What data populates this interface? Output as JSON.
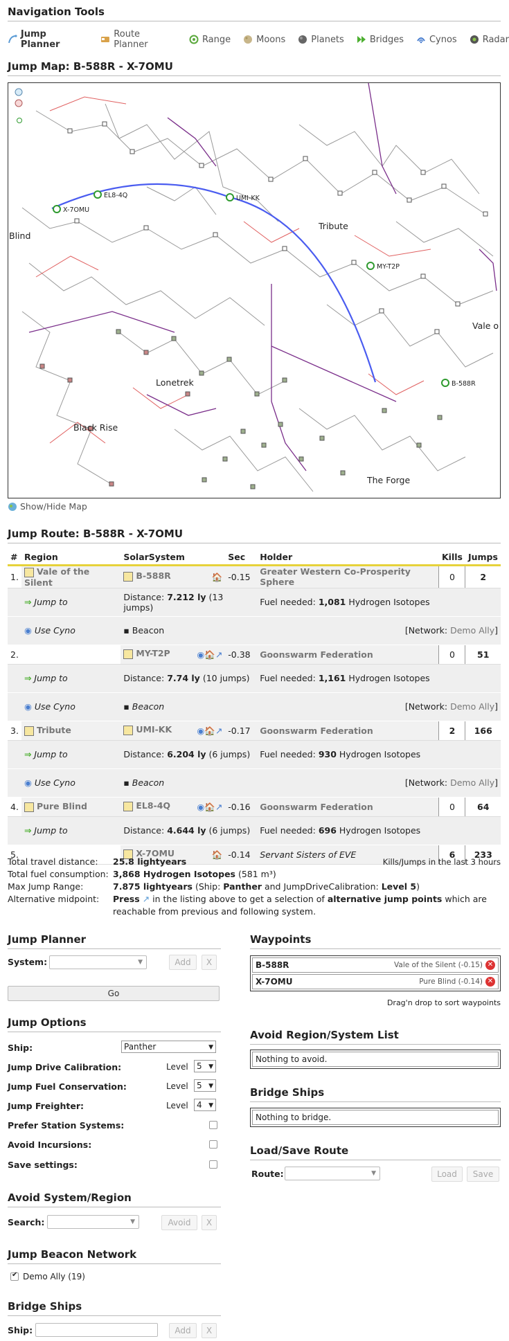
{
  "nav": {
    "title": "Navigation Tools",
    "items": [
      {
        "label": "Jump Planner",
        "icon": "jump-planner-icon",
        "active": true
      },
      {
        "label": "Route Planner",
        "icon": "route-planner-icon"
      },
      {
        "label": "Range",
        "icon": "range-icon"
      },
      {
        "label": "Moons",
        "icon": "moon-icon"
      },
      {
        "label": "Planets",
        "icon": "planet-icon"
      },
      {
        "label": "Bridges",
        "icon": "bridges-icon"
      },
      {
        "label": "Cynos",
        "icon": "cyno-icon"
      },
      {
        "label": "Radar",
        "icon": "radar-icon"
      }
    ]
  },
  "map": {
    "title": "Jump Map: B-588R - X-7OMU",
    "labels": {
      "blind": "Blind",
      "tribute": "Tribute",
      "vale": "Vale o",
      "lonetrek": "Lonetrek",
      "black_rise": "Black Rise",
      "the_forge": "The Forge"
    },
    "route_systems": [
      "X-7OMU",
      "EL8-4Q",
      "UMI-KK",
      "MY-T2P",
      "B-588R"
    ],
    "show_hide": "Show/Hide Map"
  },
  "route": {
    "title": "Jump Route: B-588R - X-7OMU",
    "columns": [
      "#",
      "Region",
      "SolarSystem",
      "Sec",
      "Holder",
      "Kills",
      "Jumps"
    ],
    "rows": [
      {
        "num": "1.",
        "region": "Vale of the Silent",
        "system": "B-588R",
        "sec": "-0.15",
        "holder": "Greater Western Co-Prosperity Sphere",
        "kills": "0",
        "jumps": "2",
        "jump_label": "Jump to",
        "distance_label": "Distance:",
        "distance": "7.212 ly",
        "distance_jumps": "(13 jumps)",
        "fuel_label": "Fuel needed:",
        "fuel": "1,081",
        "fuel_type": "Hydrogen Isotopes",
        "cyno_label": "Use Cyno",
        "beacon": "Beacon",
        "network_label": "[Network:",
        "network": "Demo Ally",
        "network_end": "]"
      },
      {
        "num": "2.",
        "region": "",
        "system": "MY-T2P",
        "sec": "-0.38",
        "holder": "Goonswarm Federation",
        "kills": "0",
        "jumps": "51",
        "jump_label": "Jump to",
        "distance_label": "Distance:",
        "distance": "7.74 ly",
        "distance_jumps": "(10 jumps)",
        "fuel_label": "Fuel needed:",
        "fuel": "1,161",
        "fuel_type": "Hydrogen Isotopes",
        "cyno_label": "Use Cyno",
        "beacon": "Beacon",
        "network_label": "[Network:",
        "network": "Demo Ally",
        "network_end": "]"
      },
      {
        "num": "3.",
        "region": "Tribute",
        "system": "UMI-KK",
        "sec": "-0.17",
        "holder": "Goonswarm Federation",
        "kills": "2",
        "jumps": "166",
        "jump_label": "Jump to",
        "distance_label": "Distance:",
        "distance": "6.204 ly",
        "distance_jumps": "(6 jumps)",
        "fuel_label": "Fuel needed:",
        "fuel": "930",
        "fuel_type": "Hydrogen Isotopes",
        "cyno_label": "Use Cyno",
        "beacon": "Beacon",
        "network_label": "[Network:",
        "network": "Demo Ally",
        "network_end": "]"
      },
      {
        "num": "4.",
        "region": "Pure Blind",
        "system": "EL8-4Q",
        "sec": "-0.16",
        "holder": "Goonswarm Federation",
        "kills": "0",
        "jumps": "64",
        "jump_label": "Jump to",
        "distance_label": "Distance:",
        "distance": "4.644 ly",
        "distance_jumps": "(6 jumps)",
        "fuel_label": "Fuel needed:",
        "fuel": "696",
        "fuel_type": "Hydrogen Isotopes"
      },
      {
        "num": "5.",
        "region": "",
        "system": "X-7OMU",
        "sec": "-0.14",
        "holder": "Servant Sisters of EVE",
        "kills": "6",
        "jumps": "233"
      }
    ]
  },
  "stats": {
    "travel_label": "Total travel distance:",
    "travel": "25.8 lightyears",
    "kills_note": "Kills/Jumps in the last 3 hours",
    "fuel_label": "Total fuel consumption:",
    "fuel": "3,868 Hydrogen Isotopes",
    "fuel_volume": "(581 m³)",
    "range_label": "Max Jump Range:",
    "range": "7.875 lightyears",
    "range_ship_pre": "(Ship:",
    "range_ship": "Panther",
    "range_mid": "and JumpDriveCalibration:",
    "range_level": "Level 5",
    "range_end": ")",
    "alt_label": "Alternative midpoint:",
    "alt_press": "Press",
    "alt_text1": "in the listing above to get a selection of",
    "alt_bold": "alternative jump points",
    "alt_text2": "which are reachable from previous and following system."
  },
  "planner": {
    "title": "Jump Planner",
    "system_label": "System:",
    "add": "Add",
    "x": "X",
    "go": "Go"
  },
  "waypoints": {
    "title": "Waypoints",
    "items": [
      {
        "name": "B-588R",
        "region": "Vale of the Silent (-0.15)"
      },
      {
        "name": "X-7OMU",
        "region": "Pure Blind (-0.14)"
      }
    ],
    "hint": "Drag'n drop to sort waypoints"
  },
  "options": {
    "title": "Jump Options",
    "ship_label": "Ship:",
    "ship": "Panther",
    "jdc_label": "Jump Drive Calibration:",
    "jdc_level": "Level",
    "jdc": "5",
    "jfc_label": "Jump Fuel Conservation:",
    "jfc_level": "Level",
    "jfc": "5",
    "jf_label": "Jump Freighter:",
    "jf_level": "Level",
    "jf": "4",
    "prefer_label": "Prefer Station Systems:",
    "incursions_label": "Avoid Incursions:",
    "save_label": "Save settings:"
  },
  "avoid_list": {
    "title": "Avoid Region/System List",
    "text": "Nothing to avoid."
  },
  "bridge_list": {
    "title": "Bridge Ships",
    "text": "Nothing to bridge."
  },
  "load_save": {
    "title": "Load/Save Route",
    "route_label": "Route:",
    "load": "Load",
    "save": "Save"
  },
  "avoid_search": {
    "title": "Avoid System/Region",
    "search_label": "Search:",
    "avoid": "Avoid",
    "x": "X"
  },
  "beacon_net": {
    "title": "Jump Beacon Network",
    "item": "Demo Ally (19)"
  },
  "bridge_ships": {
    "title": "Bridge Ships",
    "ship_label": "Ship:",
    "add": "Add",
    "x": "X"
  },
  "colors": {
    "route_line": "#4a5cf0",
    "accent": "#e6d23a",
    "link": "#555",
    "purple_edge": "#7a2e8a",
    "red_edge": "#e06060"
  }
}
